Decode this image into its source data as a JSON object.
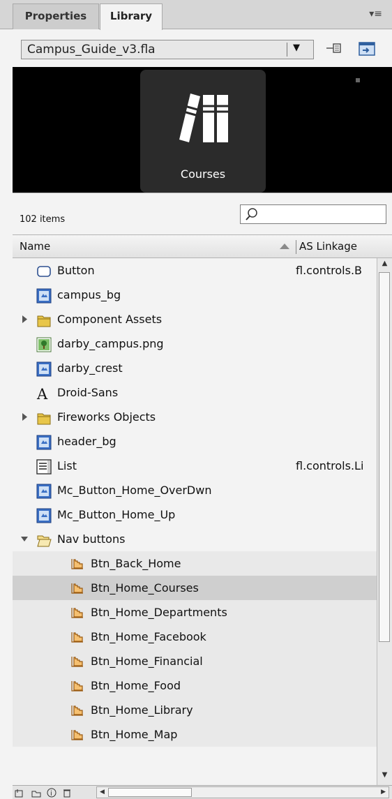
{
  "tabs": [
    {
      "label": "Properties",
      "active": false
    },
    {
      "label": "Library",
      "active": true
    }
  ],
  "document": {
    "name": "Campus_Guide_v3.fla"
  },
  "preview": {
    "label": "Courses"
  },
  "library": {
    "item_count": "102 items",
    "search": {
      "value": "",
      "placeholder": ""
    },
    "columns": {
      "name": "Name",
      "linkage": "AS Linkage"
    },
    "items": [
      {
        "label": "Button",
        "icon": "component-icon",
        "linkage": "fl.controls.B",
        "indent": 0
      },
      {
        "label": "campus_bg",
        "icon": "movieclip-icon",
        "linkage": "",
        "indent": 0
      },
      {
        "label": "Component Assets",
        "icon": "folder-closed-icon",
        "linkage": "",
        "indent": 0,
        "folder": "collapsed"
      },
      {
        "label": "darby_campus.png",
        "icon": "bitmap-icon",
        "linkage": "",
        "indent": 0
      },
      {
        "label": "darby_crest",
        "icon": "movieclip-icon",
        "linkage": "",
        "indent": 0
      },
      {
        "label": "Droid-Sans",
        "icon": "font-icon",
        "linkage": "",
        "indent": 0
      },
      {
        "label": "Fireworks Objects",
        "icon": "folder-closed-icon",
        "linkage": "",
        "indent": 0,
        "folder": "collapsed"
      },
      {
        "label": "header_bg",
        "icon": "movieclip-icon",
        "linkage": "",
        "indent": 0
      },
      {
        "label": "List",
        "icon": "list-component-icon",
        "linkage": "fl.controls.Li",
        "indent": 0
      },
      {
        "label": "Mc_Button_Home_OverDwn",
        "icon": "movieclip-icon",
        "linkage": "",
        "indent": 0
      },
      {
        "label": "Mc_Button_Home_Up",
        "icon": "movieclip-icon",
        "linkage": "",
        "indent": 0
      },
      {
        "label": "Nav buttons",
        "icon": "folder-open-icon",
        "linkage": "",
        "indent": 0,
        "folder": "expanded"
      },
      {
        "label": "Btn_Back_Home",
        "icon": "button-symbol-icon",
        "linkage": "",
        "indent": 1
      },
      {
        "label": "Btn_Home_Courses",
        "icon": "button-symbol-icon",
        "linkage": "",
        "indent": 1,
        "selected": true
      },
      {
        "label": "Btn_Home_Departments",
        "icon": "button-symbol-icon",
        "linkage": "",
        "indent": 1
      },
      {
        "label": "Btn_Home_Facebook",
        "icon": "button-symbol-icon",
        "linkage": "",
        "indent": 1
      },
      {
        "label": "Btn_Home_Financial",
        "icon": "button-symbol-icon",
        "linkage": "",
        "indent": 1
      },
      {
        "label": "Btn_Home_Food",
        "icon": "button-symbol-icon",
        "linkage": "",
        "indent": 1
      },
      {
        "label": "Btn_Home_Library",
        "icon": "button-symbol-icon",
        "linkage": "",
        "indent": 1
      },
      {
        "label": "Btn_Home_Map",
        "icon": "button-symbol-icon",
        "linkage": "",
        "indent": 1
      }
    ]
  },
  "colors": {
    "selected_row": "#cfcfcf",
    "child_row": "#e9e9e9",
    "preview_bg": "#000000",
    "movieclip_blue": "#3a6fc4",
    "folder_yellow": "#e8c64a",
    "button_orange": "#e89a2a"
  }
}
